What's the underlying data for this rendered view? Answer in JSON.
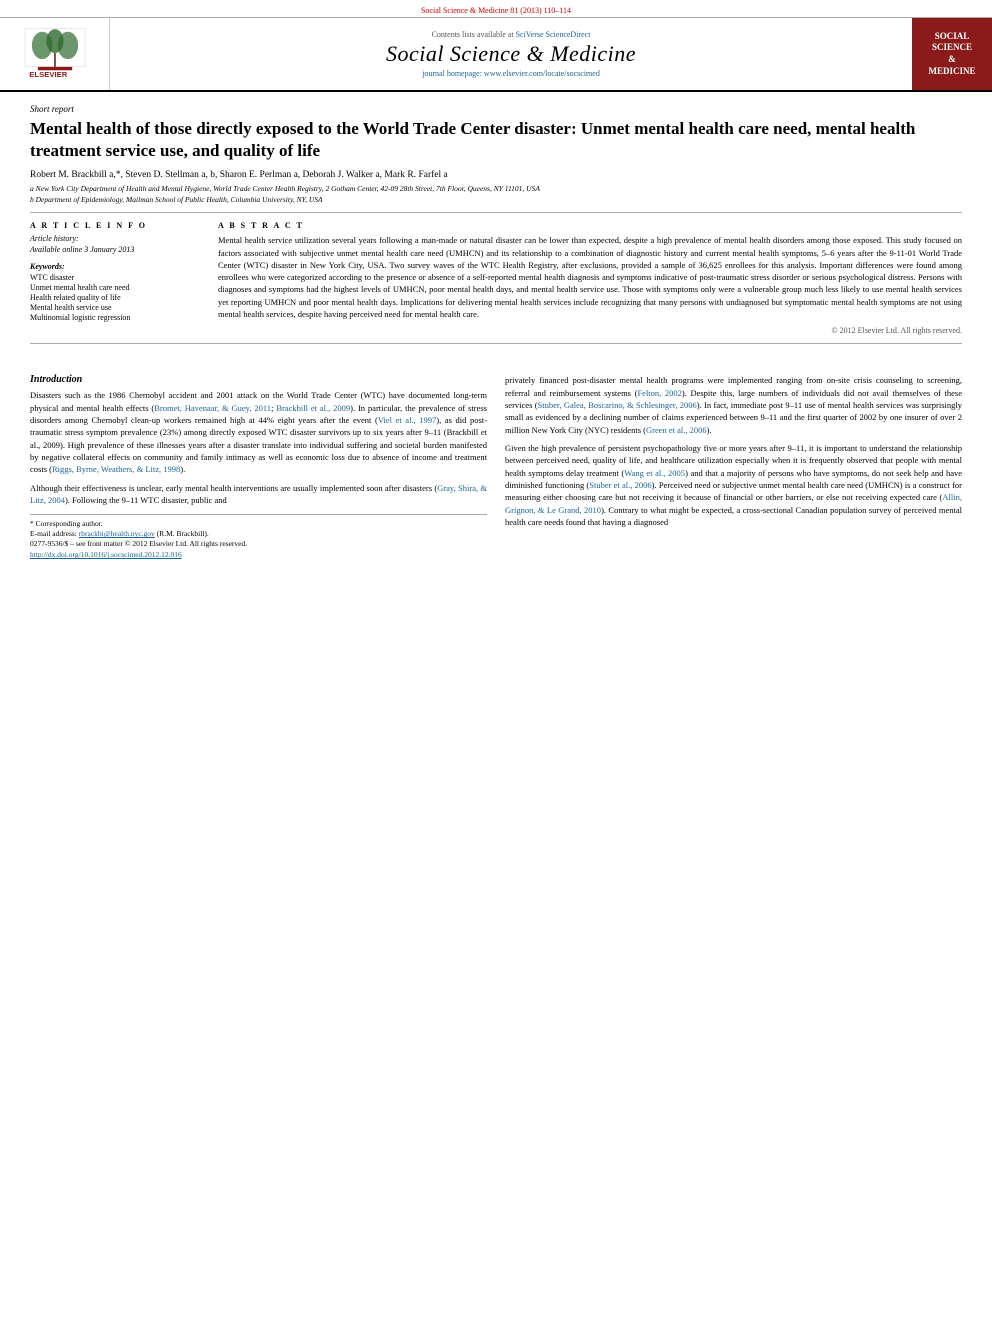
{
  "top_header": {
    "journal_ref": "Social Science & Medicine 81 (2013) 110–114"
  },
  "journal_header": {
    "sciverse_text": "Contents lists available at ",
    "sciverse_link": "SciVerse ScienceDirect",
    "journal_title": "Social Science & Medicine",
    "homepage_text": "journal homepage: www.elsevier.com/locate/socscimed",
    "badge_line1": "SOCIAL",
    "badge_line2": "SCIENCE",
    "badge_line3": "&",
    "badge_line4": "MEDICINE"
  },
  "article": {
    "type_label": "Short report",
    "title": "Mental health of those directly exposed to the World Trade Center disaster: Unmet mental health care need, mental health treatment service use, and quality of life",
    "authors": "Robert M. Brackbill a,*, Steven D. Stellman a, b, Sharon E. Perlman a, Deborah J. Walker a, Mark R. Farfel a",
    "affiliation_a": "a New York City Department of Health and Mental Hygiene, World Trade Center Health Registry, 2 Gotham Center, 42-09 28th Street, 7th Floor, Queens, NY 11101, USA",
    "affiliation_b": "b Department of Epidemiology, Mailman School of Public Health, Columbia University, NY, USA"
  },
  "article_info": {
    "section_label": "A R T I C L E   I N F O",
    "history_label": "Article history:",
    "available_online": "Available online 3 January 2013",
    "keywords_label": "Keywords:",
    "keywords": [
      "WTC disaster",
      "Unmet mental health care need",
      "Health related quality of life",
      "Mental health service use",
      "Multinomial logistic regression"
    ]
  },
  "abstract": {
    "section_label": "A B S T R A C T",
    "text": "Mental health service utilization several years following a man-made or natural disaster can be lower than expected, despite a high prevalence of mental health disorders among those exposed. This study focused on factors associated with subjective unmet mental health care need (UMHCN) and its relationship to a combination of diagnostic history and current mental health symptoms, 5–6 years after the 9-11-01 World Trade Center (WTC) disaster in New York City, USA. Two survey waves of the WTC Health Registry, after exclusions, provided a sample of 36,625 enrollees for this analysis. Important differences were found among enrollees who were categorized according to the presence or absence of a self-reported mental health diagnosis and symptoms indicative of post-traumatic stress disorder or serious psychological distress. Persons with diagnoses and symptoms had the highest levels of UMHCN, poor mental health days, and mental health service use. Those with symptoms only were a vulnerable group much less likely to use mental health services yet reporting UMHCN and poor mental health days. Implications for delivering mental health services include recognizing that many persons with undiagnosed but symptomatic mental health symptoms are not using mental health services, despite having perceived need for mental health care.",
    "copyright": "© 2012 Elsevier Ltd. All rights reserved."
  },
  "introduction": {
    "heading": "Introduction",
    "para1": "Disasters such as the 1986 Chernobyl accident and 2001 attack on the World Trade Center (WTC) have documented long-term physical and mental health effects (Bromet, Havenaar, & Guey, 2011; Brackbill et al., 2009). In particular, the prevalence of stress disorders among Chernobyl clean-up workers remained high at 44% eight years after the event (Viel et al., 1997), as did post-traumatic stress symptom prevalence (23%) among directly exposed WTC disaster survivors up to six years after 9–11 (Brackbill et al., 2009). High prevalence of these illnesses years after a disaster translate into individual suffering and societal burden manifested by negative collateral effects on community and family intimacy as well as economic loss due to absence of income and treatment costs (Riggs, Byrne, Weathers, & Litz, 1998).",
    "para2": "Although their effectiveness is unclear, early mental health interventions are usually implemented soon after disasters (Gray, Shira, & Litz, 2004). Following the 9–11 WTC disaster, public and"
  },
  "right_col_intro": {
    "para1": "privately financed post-disaster mental health programs were implemented ranging from on-site crisis counseling to screening, referral and reimbursement systems (Felton, 2002). Despite this, large numbers of individuals did not avail themselves of these services (Stuber, Galea, Boscarino, & Schlesinger, 2006). In fact, immediate post 9–11 use of mental health services was surprisingly small as evidenced by a declining number of claims experienced between 9–11 and the first quarter of 2002 by one insurer of over 2 million New York City (NYC) residents (Green et al., 2006).",
    "para2": "Given the high prevalence of persistent psychopathology five or more years after 9–11, it is important to understand the relationship between perceived need, quality of life, and healthcare utilization especially when it is frequently observed that people with mental health symptoms delay treatment (Wang et al., 2005) and that a majority of persons who have symptoms, do not seek help and have diminished functioning (Stuber et al., 2006). Perceived need or subjective unmet mental health care need (UMHCN) is a construct for measuring either choosing care but not receiving it because of financial or other barriers, or else not receiving expected care (Allin, Grignon, & Le Grand, 2010). Contrary to what might be expected, a cross-sectional Canadian population survey of perceived mental health care needs found that having a diagnosed"
  },
  "footnotes": {
    "corresponding_label": "* Corresponding author.",
    "email_label": "E-mail address: ",
    "email": "rbrackbi@health.nyc.gov",
    "email_suffix": " (R.M. Brackbill).",
    "issn_line": "0277-9536/$ – see front matter © 2012 Elsevier Ltd. All rights reserved.",
    "doi": "http://dx.doi.org/10.1016/j.socscimed.2012.12.016"
  }
}
